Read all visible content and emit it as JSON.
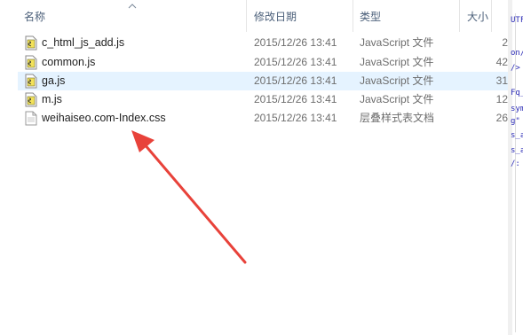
{
  "columns": {
    "name": "名称",
    "date": "修改日期",
    "type": "类型",
    "size": "大小"
  },
  "files": [
    {
      "name": "c_html_js_add.js",
      "date": "2015/12/26 13:41",
      "type": "JavaScript 文件",
      "size": "2",
      "icon": "js-file-icon",
      "selected": false
    },
    {
      "name": "common.js",
      "date": "2015/12/26 13:41",
      "type": "JavaScript 文件",
      "size": "42",
      "icon": "js-file-icon",
      "selected": false
    },
    {
      "name": "ga.js",
      "date": "2015/12/26 13:41",
      "type": "JavaScript 文件",
      "size": "31",
      "icon": "js-file-icon",
      "selected": true
    },
    {
      "name": "m.js",
      "date": "2015/12/26 13:41",
      "type": "JavaScript 文件",
      "size": "12",
      "icon": "js-file-icon",
      "selected": false
    },
    {
      "name": "weihaiseo.com-Index.css",
      "date": "2015/12/26 13:41",
      "type": "层叠样式表文档",
      "size": "26",
      "icon": "css-file-icon",
      "selected": false
    }
  ],
  "background_editor_fragments": [
    "UTF",
    "on/",
    "/>",
    "Fq_",
    "sym",
    "g\"",
    "s_a",
    "s_a",
    "/:"
  ],
  "colors": {
    "selected_row": "#e5f3ff",
    "header_text": "#4c607a",
    "annotation_arrow": "#e8423a"
  }
}
